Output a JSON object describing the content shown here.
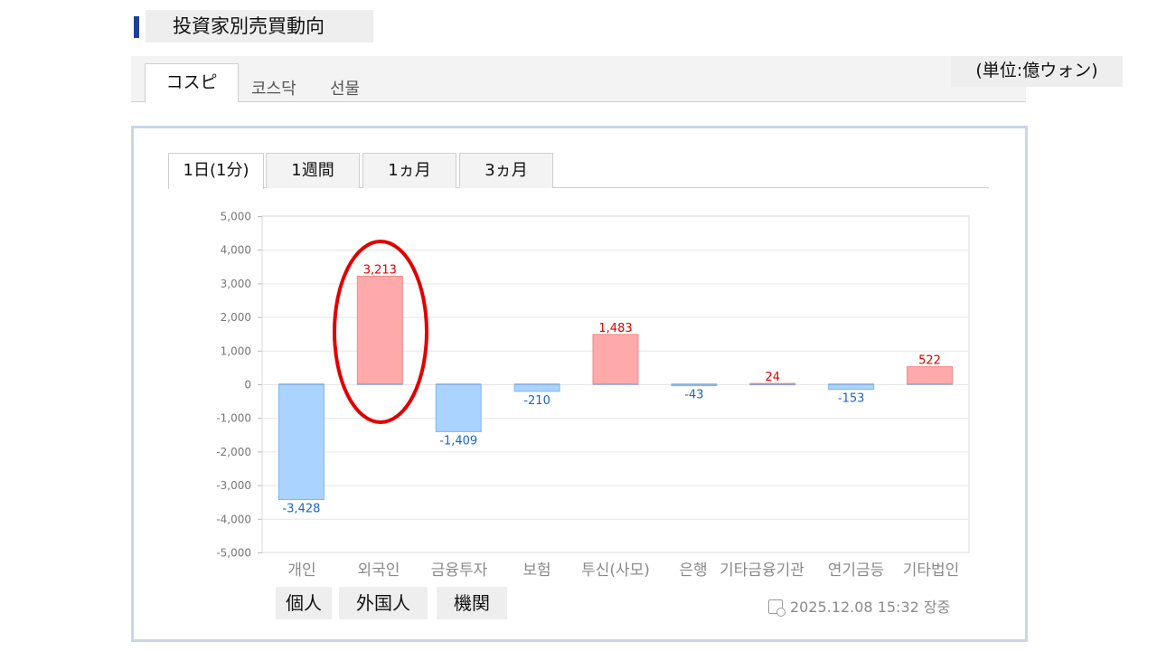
{
  "header": {
    "title": "投資家別売買動向"
  },
  "market_tabs": [
    "コスピ",
    "코스닥",
    "선물"
  ],
  "unit_label": "(単位:億ウォン)",
  "period_tabs": [
    "1日(1分)",
    "1週間",
    "1ヵ月",
    "3ヵ月"
  ],
  "investor_groups": [
    "個人",
    "外国人",
    "機関"
  ],
  "timestamp": "2025.12.08 15:32 장중",
  "colors": {
    "positive_fill": "#ffaaaa",
    "positive_text": "#e00000",
    "negative_fill": "#aad4ff",
    "negative_text": "#1a66c8",
    "highlight": "#e00000"
  },
  "chart_data": {
    "type": "bar",
    "categories": [
      "개인",
      "외국인",
      "금융투자",
      "보험",
      "투신(사모)",
      "은행",
      "기타금융",
      "기관",
      "연기금등",
      "기타법인"
    ],
    "tick_labels": [
      "개인",
      "외국인",
      "금융투자",
      "보험",
      "투신(사모)",
      "은행",
      "기타금융기관",
      "연기금등",
      "기타법인"
    ],
    "values": [
      -3428,
      3213,
      -1409,
      -210,
      1483,
      -43,
      24,
      -153,
      522
    ],
    "value_labels": [
      "-3,428",
      "3,213",
      "-1,409",
      "-210",
      "1,483",
      "-43",
      "24",
      "-153",
      "522"
    ],
    "ylim": [
      -5000,
      5000
    ],
    "yticks": [
      5000,
      4000,
      3000,
      2000,
      1000,
      0,
      -1000,
      -2000,
      -3000,
      -4000,
      -5000
    ],
    "ytick_labels": [
      "5,000",
      "4,000",
      "3,000",
      "2,000",
      "1,000",
      "0",
      "-1,000",
      "-2,000",
      "-3,000",
      "-4,000",
      "-5,000"
    ],
    "grid": true,
    "highlighted_category": "외국인"
  }
}
